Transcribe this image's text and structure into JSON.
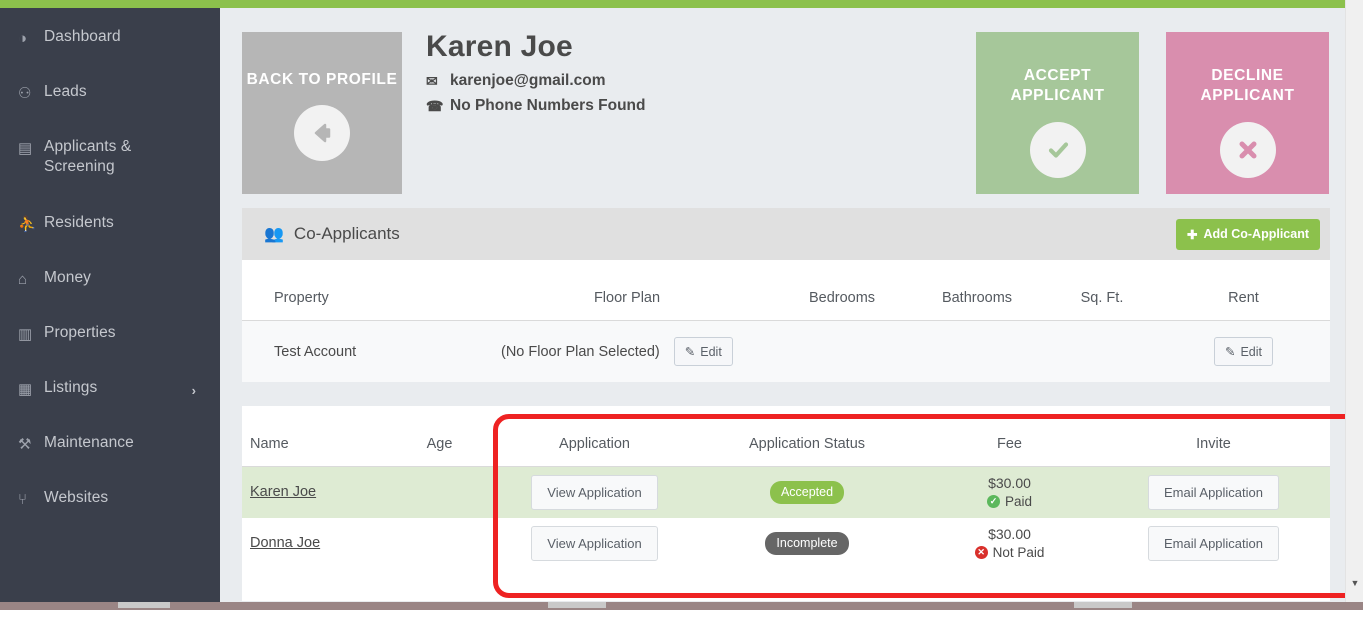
{
  "theme": {
    "accent_green": "#8CC14C",
    "sidebar_bg": "#3A3F4B",
    "accept_green": "#A6C79A",
    "decline_pink": "#D98EAE",
    "annotation_red": "#EE2222",
    "row_highlight": "#DEEBD3"
  },
  "sidebar": {
    "items": [
      {
        "label": "Dashboard",
        "icon": "dashboard-icon",
        "glyph": "◑",
        "has_chevron": false
      },
      {
        "label": "Leads",
        "icon": "user-plus-icon",
        "glyph": "⚇",
        "has_chevron": false
      },
      {
        "label": "Applicants & Screening",
        "icon": "document-icon",
        "glyph": "▤",
        "has_chevron": false
      },
      {
        "label": "Residents",
        "icon": "users-icon",
        "glyph": "⛹",
        "has_chevron": false
      },
      {
        "label": "Money",
        "icon": "bank-icon",
        "glyph": "⌂",
        "has_chevron": false
      },
      {
        "label": "Properties",
        "icon": "building-icon",
        "glyph": "▥",
        "has_chevron": false
      },
      {
        "label": "Listings",
        "icon": "list-icon",
        "glyph": "▦",
        "has_chevron": true,
        "chevron": "›"
      },
      {
        "label": "Maintenance",
        "icon": "wrench-icon",
        "glyph": "⚒",
        "has_chevron": false
      },
      {
        "label": "Websites",
        "icon": "sitemap-icon",
        "glyph": "⑂",
        "has_chevron": false
      }
    ]
  },
  "header": {
    "back_button": {
      "label": "BACK TO PROFILE",
      "icon": "arrow-left-circle-icon"
    },
    "applicant": {
      "name": "Karen Joe",
      "email": "karenjoe@gmail.com",
      "email_icon": "envelope-icon",
      "phone": "No Phone Numbers Found",
      "phone_icon": "phone-icon"
    },
    "accept_button": {
      "label": "ACCEPT APPLICANT",
      "icon": "check-circle-icon"
    },
    "decline_button": {
      "label": "DECLINE APPLICANT",
      "icon": "times-circle-icon"
    }
  },
  "co_applicants_panel": {
    "title": "Co-Applicants",
    "title_icon": "users-icon",
    "add_button": {
      "label": "Add Co-Applicant",
      "icon": "plus-circle-icon"
    }
  },
  "property_table": {
    "columns": [
      "Property",
      "Floor Plan",
      "Bedrooms",
      "Bathrooms",
      "Sq. Ft.",
      "Rent"
    ],
    "rows": [
      {
        "property": "Test Account",
        "floor_plan": "(No Floor Plan Selected)",
        "floor_plan_edit": "Edit",
        "bedrooms": "",
        "bathrooms": "",
        "sq_ft": "",
        "rent": "",
        "rent_edit": "Edit"
      }
    ],
    "edit_icon": "pencil-square-icon"
  },
  "applicants_table": {
    "columns": [
      "Name",
      "Age",
      "Application",
      "Application Status",
      "Fee",
      "Invite"
    ],
    "rows": [
      {
        "name": "Karen Joe",
        "age": "",
        "application_button": "View Application",
        "status": "Accepted",
        "status_kind": "accepted",
        "fee_amount": "$30.00",
        "fee_status": "Paid",
        "fee_paid": true,
        "invite_button": "Email Application",
        "highlighted": true
      },
      {
        "name": "Donna Joe",
        "age": "",
        "application_button": "View Application",
        "status": "Incomplete",
        "status_kind": "incomplete",
        "fee_amount": "$30.00",
        "fee_status": "Not Paid",
        "fee_paid": false,
        "invite_button": "Email Application",
        "highlighted": false
      }
    ]
  },
  "annotation": {
    "shape": "rounded-rectangle",
    "color": "#EE2222"
  },
  "scrollbar": {
    "down_arrow": "▼"
  }
}
